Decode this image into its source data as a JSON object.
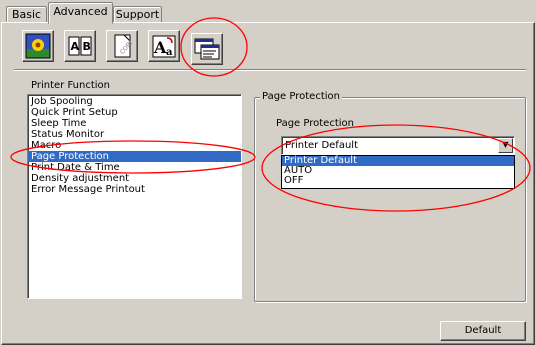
{
  "tabs": [
    {
      "label": "Basic",
      "active": false
    },
    {
      "label": "Advanced",
      "active": true
    },
    {
      "label": "Support",
      "active": false
    }
  ],
  "toolbar": {
    "icons": [
      "print-quality-icon",
      "duplex-icon",
      "watermark-icon",
      "font-settings-icon",
      "device-options-icon"
    ],
    "selected": "device-options-icon"
  },
  "printer_function": {
    "label": "Printer Function",
    "items": [
      "Job Spooling",
      "Quick Print Setup",
      "Sleep Time",
      "Status Monitor",
      "Macro",
      "Page Protection",
      "Print Date & Time",
      "Density adjustment",
      "Error Message Printout"
    ],
    "selected_index": 5
  },
  "page_protection": {
    "group_title": "Page Protection",
    "field_label": "Page Protection",
    "current_value": "Printer Default",
    "options": [
      "Printer Default",
      "AUTO",
      "OFF"
    ],
    "highlighted_option": "Printer Default"
  },
  "footer": {
    "default_label": "Default"
  },
  "colors": {
    "background": "#d4d0c8",
    "selection": "#316ac5",
    "annotation": "#ff0000"
  }
}
